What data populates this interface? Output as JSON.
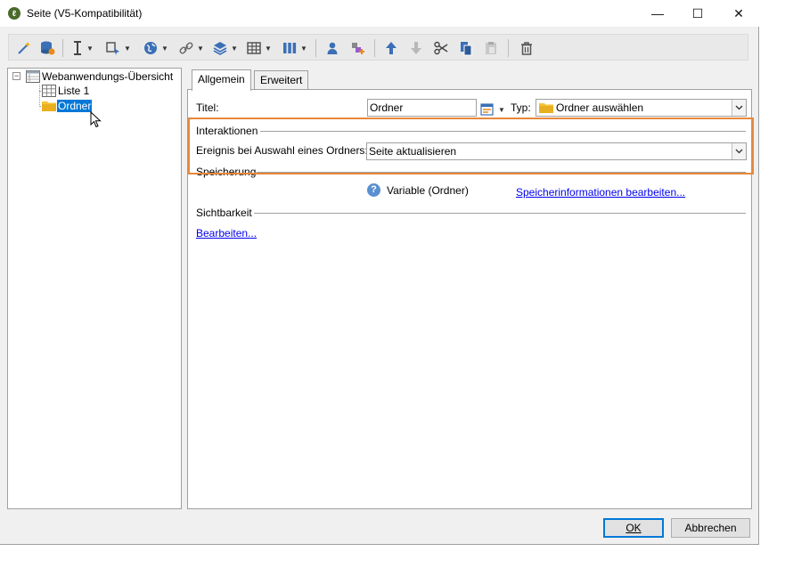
{
  "window": {
    "title": "Seite (V5-Kompatibilität)",
    "minimize": "—",
    "maximize": "☐",
    "close": "✕"
  },
  "tree": {
    "root": "Webanwendungs-Übersicht",
    "items": [
      "Liste 1",
      "Ordner"
    ],
    "selected": "Ordner",
    "expander": "−"
  },
  "tabs": [
    "Allgemein",
    "Erweitert"
  ],
  "form": {
    "title_label": "Titel:",
    "title_value": "Ordner",
    "type_label": "Typ:",
    "type_value": "Ordner auswählen",
    "interactions_section": "Interaktionen",
    "event_label": "Ereignis bei Auswahl eines Ordners:",
    "event_value": "Seite aktualisieren",
    "storage_section": "Speicherung",
    "storage_variable": "Variable (Ordner)",
    "storage_link": "Speicherinformationen bearbeiten...",
    "visibility_section": "Sichtbarkeit",
    "visibility_link": "Bearbeiten..."
  },
  "buttons": {
    "ok": "OK",
    "cancel": "Abbrechen"
  },
  "colors": {
    "highlight": "#e8883a",
    "selection": "#0078d7",
    "folder": "#f5c333",
    "link": "#0000ee"
  }
}
